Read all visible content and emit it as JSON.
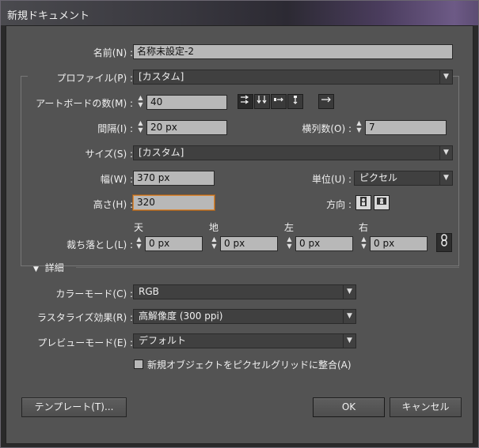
{
  "window": {
    "title": "新規ドキュメント"
  },
  "name": {
    "label": "名前(N) :",
    "value": "名称未設定-2"
  },
  "profile": {
    "label": "プロファイル(P) :",
    "value": "[カスタム]"
  },
  "artboards": {
    "label": "アートボードの数(M) :",
    "value": "40"
  },
  "spacing": {
    "label": "間隔(I) :",
    "value": "20 px"
  },
  "columns": {
    "label": "横列数(O) :",
    "value": "7"
  },
  "size": {
    "label": "サイズ(S) :",
    "value": "[カスタム]"
  },
  "width": {
    "label": "幅(W) :",
    "value": "370 px"
  },
  "units": {
    "label": "単位(U) :",
    "value": "ピクセル"
  },
  "height": {
    "label": "高さ(H) :",
    "value": "320"
  },
  "orientation": {
    "label": "方向 :"
  },
  "bleed": {
    "label": "裁ち落とし(L) :",
    "top": {
      "label": "天",
      "value": "0 px"
    },
    "bottom": {
      "label": "地",
      "value": "0 px"
    },
    "left": {
      "label": "左",
      "value": "0 px"
    },
    "right": {
      "label": "右",
      "value": "0 px"
    }
  },
  "advanced": {
    "label": "詳細"
  },
  "color_mode": {
    "label": "カラーモード(C) :",
    "value": "RGB"
  },
  "raster": {
    "label": "ラスタライズ効果(R) :",
    "value": "高解像度 (300 ppi)"
  },
  "preview": {
    "label": "プレビューモード(E) :",
    "value": "デフォルト"
  },
  "pixel_grid": {
    "label": "新規オブジェクトをピクセルグリッドに整合(A)",
    "checked": false
  },
  "buttons": {
    "templates": "テンプレート(T)...",
    "ok": "OK",
    "cancel": "キャンセル"
  }
}
